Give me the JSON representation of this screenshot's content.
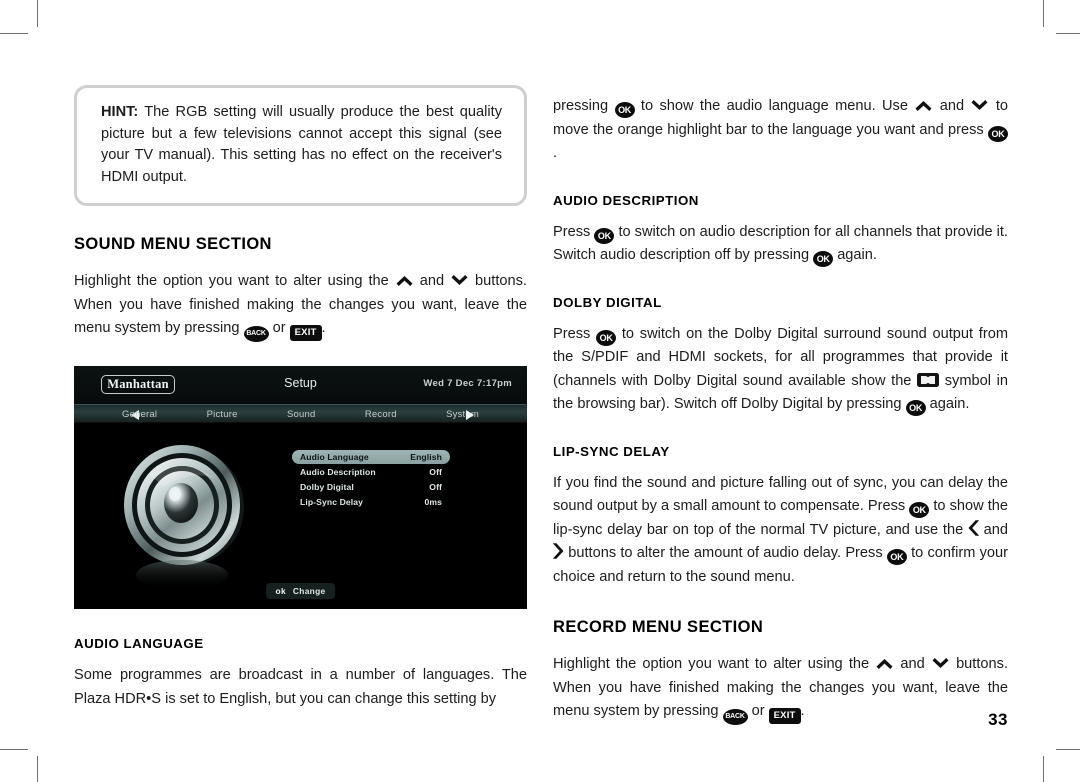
{
  "document": {
    "page_number": "33"
  },
  "left_column": {
    "hint": {
      "label": "HINT:",
      "text": " The RGB setting will usually produce the best quality picture but a few televisions cannot accept this signal (see your TV manual). This setting has no effect on the receiver's HDMI output."
    },
    "section_heading": "SOUND MENU SECTION",
    "intro_paragraph": {
      "part1": "Highlight the option you want to alter using the ",
      "part2": " and ",
      "part3": " buttons. When you have finished making the changes you want, leave the menu system by pressing ",
      "part4": " or ",
      "part5": ".",
      "key_up": "up-chevron",
      "key_down": "down-chevron",
      "key_back": "BACK",
      "key_exit": "EXIT"
    },
    "audio_language": {
      "heading": "AUDIO LANGUAGE",
      "text": "Some programmes are broadcast in a number of languages. The Plaza HDR•S is set to English, but you can change this setting by"
    }
  },
  "tv_screen": {
    "logo": "Manhattan",
    "title": "Setup",
    "datetime": "Wed 7 Dec 7:17pm",
    "nav_tabs": [
      "General",
      "Picture",
      "Sound",
      "Record",
      "System"
    ],
    "nav_left_arrow": "left-triangle-icon",
    "nav_right_arrow": "right-triangle-icon",
    "settings_rows": [
      {
        "label": "Audio Language",
        "value": "English",
        "highlighted": true
      },
      {
        "label": "Audio Description",
        "value": "Off",
        "highlighted": false
      },
      {
        "label": "Dolby Digital",
        "value": "Off",
        "highlighted": false
      },
      {
        "label": "Lip-Sync Delay",
        "value": "0ms",
        "highlighted": false
      }
    ],
    "footer_button": {
      "key": "ok",
      "label": "Change"
    },
    "speaker_icon": "speaker-icon",
    "colors": {
      "background": "#000000",
      "navbar": "#2c4040",
      "highlight_row": "#9fb4b4",
      "text": "#dfe7e7"
    }
  },
  "right_column": {
    "audio_language_cont": {
      "part1": "pressing ",
      "part2": " to show the audio language menu. Use ",
      "part3": " and ",
      "part4": " to move the orange highlight bar to the language you want and press ",
      "part5": "."
    },
    "audio_description": {
      "heading": "AUDIO DESCRIPTION",
      "part1": "Press ",
      "part2": " to switch on audio description for all channels that provide it. Switch audio description off by pressing ",
      "part3": " again."
    },
    "dolby_digital": {
      "heading": "DOLBY DIGITAL",
      "part1": "Press ",
      "part2": " to switch on the Dolby Digital surround sound output from the S/PDIF and HDMI sockets, for all programmes that provide it (channels with Dolby Digital sound available show the ",
      "part3": " symbol in the browsing bar). Switch off Dolby Digital by pressing ",
      "part4": " again.",
      "symbol": "dolby-digital-icon"
    },
    "lip_sync_delay": {
      "heading": "LIP-SYNC DELAY",
      "part1": "If you find the sound and picture falling out of sync, you can delay the sound output by a small amount to compensate. Press ",
      "part2": " to show the lip-sync delay bar on top of the normal TV picture, and use the ",
      "part3": " and ",
      "part4": " buttons to alter the amount of audio delay. Press ",
      "part5": " to confirm your choice and return to the sound menu."
    },
    "record_menu": {
      "heading": "RECORD MENU SECTION",
      "part1": "Highlight the option you want to alter using the ",
      "part2": " and ",
      "part3": " buttons. When you have finished making the changes you want, leave the menu system by pressing ",
      "part4": " or ",
      "part5": "."
    },
    "keys": {
      "ok": "OK",
      "back": "BACK",
      "exit": "EXIT",
      "up": "up-chevron",
      "down": "down-chevron",
      "left": "left-double-chevron",
      "right": "right-double-chevron"
    }
  }
}
